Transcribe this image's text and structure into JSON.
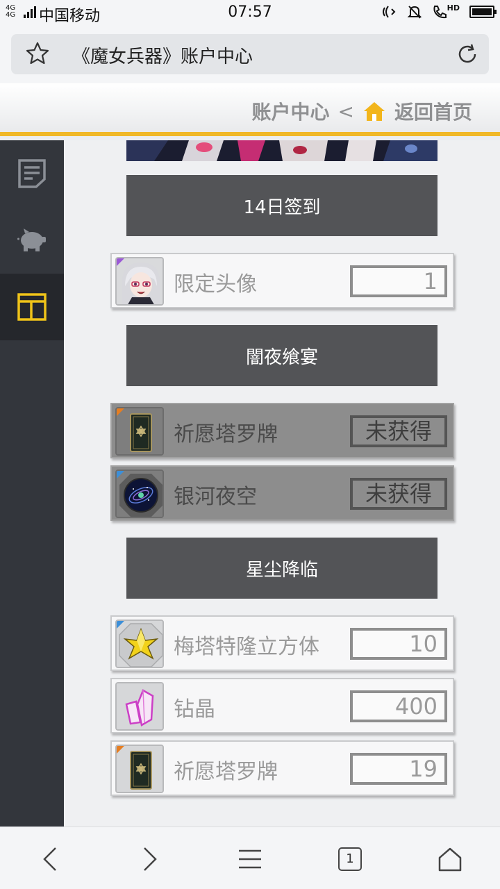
{
  "status": {
    "network": "4G 4G",
    "carrier": "中国移动",
    "time": "07:57",
    "hd": "HD"
  },
  "browser": {
    "page_title": "《魔女兵器》账户中心",
    "tab_count": "1"
  },
  "header": {
    "current": "账户中心",
    "separator": "<",
    "home_label": "返回首页"
  },
  "sidebar": {
    "items": [
      {
        "icon": "document-icon",
        "active": false
      },
      {
        "icon": "piggy-bank-icon",
        "active": false
      },
      {
        "icon": "layout-icon",
        "active": true
      }
    ],
    "accent": "#f0c419"
  },
  "sections": [
    {
      "title": "14日签到",
      "items": [
        {
          "name": "限定头像",
          "value": "1",
          "rarity": "purple",
          "locked": false
        }
      ]
    },
    {
      "title": "闇夜飨宴",
      "items": [
        {
          "name": "祈愿塔罗牌",
          "value": "未获得",
          "rarity": "orange",
          "locked": true
        },
        {
          "name": "银河夜空",
          "value": "未获得",
          "rarity": "blue",
          "locked": true
        }
      ]
    },
    {
      "title": "星尘降临",
      "items": [
        {
          "name": "梅塔特隆立方体",
          "value": "10",
          "rarity": "blue",
          "locked": false
        },
        {
          "name": "钻晶",
          "value": "400",
          "rarity": "none",
          "locked": false
        },
        {
          "name": "祈愿塔罗牌",
          "value": "19",
          "rarity": "orange",
          "locked": false
        }
      ]
    }
  ],
  "colors": {
    "header_accent": "#f0b828",
    "section_bg": "#535457",
    "sidebar_bg": "#33363c"
  }
}
